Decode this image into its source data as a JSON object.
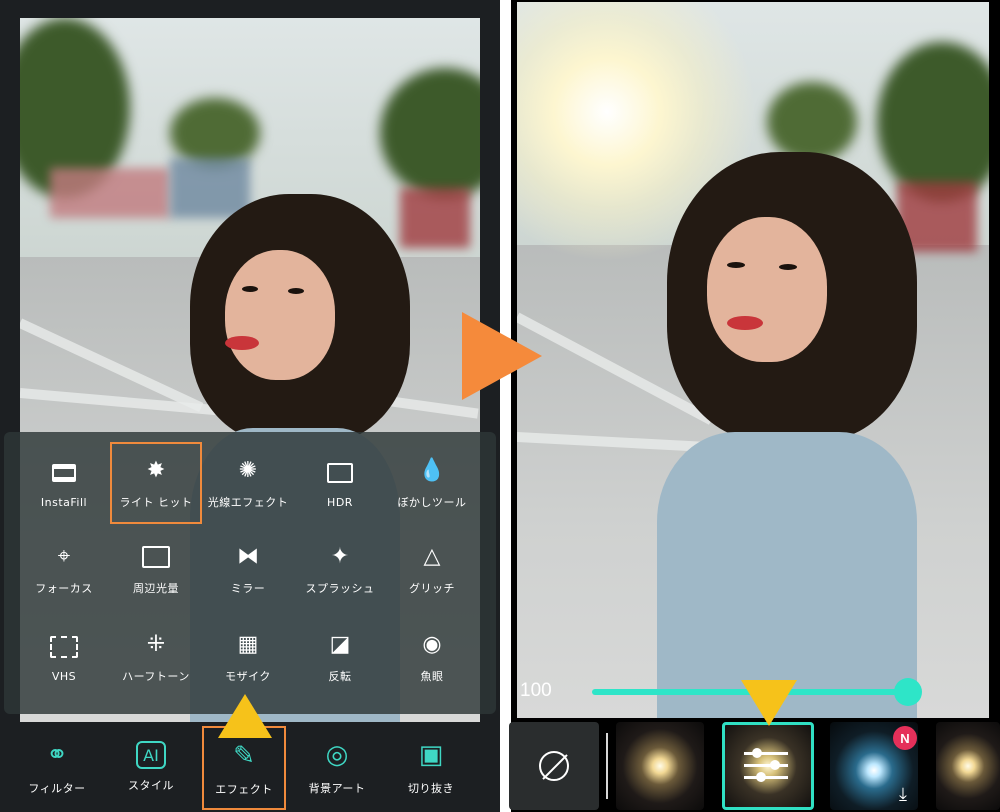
{
  "effects_panel": {
    "items": [
      {
        "label": "InstaFill",
        "icon": "instafill-icon"
      },
      {
        "label": "ライト ヒット",
        "icon": "light-hit-icon",
        "selected": true
      },
      {
        "label": "光線エフェクト",
        "icon": "light-rays-icon"
      },
      {
        "label": "HDR",
        "icon": "hdr-icon"
      },
      {
        "label": "ぼかしツール",
        "icon": "blur-drop-icon"
      },
      {
        "label": "フォーカス",
        "icon": "focus-icon"
      },
      {
        "label": "周辺光量",
        "icon": "vignette-icon"
      },
      {
        "label": "ミラー",
        "icon": "mirror-icon"
      },
      {
        "label": "スプラッシュ",
        "icon": "splash-icon"
      },
      {
        "label": "グリッチ",
        "icon": "glitch-triangle-icon"
      },
      {
        "label": "VHS",
        "icon": "vhs-icon"
      },
      {
        "label": "ハーフトーン",
        "icon": "halftone-icon"
      },
      {
        "label": "モザイク",
        "icon": "mosaic-icon"
      },
      {
        "label": "反転",
        "icon": "invert-icon"
      },
      {
        "label": "魚眼",
        "icon": "fisheye-icon"
      }
    ]
  },
  "toolbar": {
    "items": [
      {
        "label": "フィルター",
        "icon": "filter-circles-icon"
      },
      {
        "label": "スタイル",
        "icon": "ai-style-icon"
      },
      {
        "label": "エフェクト",
        "icon": "magic-wand-icon",
        "selected": true
      },
      {
        "label": "背景アート",
        "icon": "background-art-icon"
      },
      {
        "label": "切り抜き",
        "icon": "cutout-icon"
      }
    ]
  },
  "slider": {
    "value": "100",
    "level": 1.0
  },
  "thumbnails": {
    "new_badge": "N",
    "items": [
      "none-icon",
      "light-flare-thumb",
      "adjust-sliders-icon",
      "blue-flare-thumb",
      "gold-flare-thumb"
    ]
  },
  "colors": {
    "accent": "#2ee5c8",
    "highlight_orange": "#f08a3c",
    "marker_yellow": "#f6c21a",
    "badge_red": "#e5305a"
  }
}
